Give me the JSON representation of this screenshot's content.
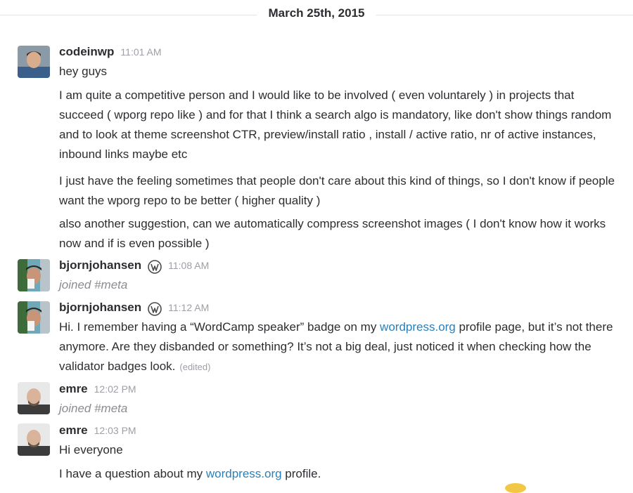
{
  "day_divider": "March 25th, 2015",
  "messages": [
    {
      "user": "codeinwp",
      "time": "11:01 AM",
      "lines": [
        "hey guys",
        "I am quite a competitive person and I would like to be involved ( even voluntarely ) in projects that succeed ( wporg repo like ) and for that I think a search algo is mandatory, like don't show things random and to look at theme screenshot CTR, preview/install ratio , install / active ratio, nr of active instances, inbound links maybe etc",
        "I just have the feeling sometimes that people don't care about this kind of things, so I don't know if people want the wporg repo to be better ( higher quality )",
        "also another suggestion, can we automatically compress screenshot images ( I don't know how it works now and if is even possible )"
      ]
    },
    {
      "user": "bjornjohansen",
      "time": "11:08 AM",
      "joined": "joined #meta"
    },
    {
      "user": "bjornjohansen",
      "time": "11:12 AM",
      "text_before_link": "Hi. I remember having a “WordCamp speaker” badge on my ",
      "link": "wordpress.org",
      "text_after_link": " profile page, but it’s not there anymore. Are they disbanded or something? It’s not a big deal, just noticed it when checking how the validator badges look.",
      "edited": "(edited)"
    },
    {
      "user": "emre",
      "time": "12:02 PM",
      "joined": "joined #meta"
    },
    {
      "user": "emre",
      "time": "12:03 PM",
      "line1": "Hi everyone",
      "text_before_link": "I have a question about my ",
      "link": "wordpress.org",
      "text_after_link": " profile."
    }
  ],
  "colors": {
    "link": "#2a80b9",
    "timestamp": "#9e9ea6",
    "text": "#2c2d30"
  },
  "icons": {
    "wordpress_badge": "wordpress-logo-icon"
  }
}
